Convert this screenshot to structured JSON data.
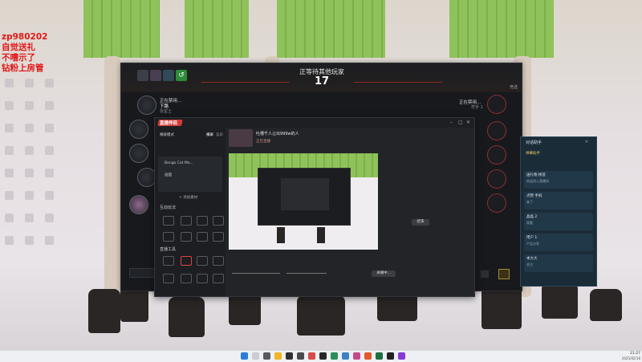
{
  "overlay_lines": [
    "zp980202",
    "自觉送礼",
    "不嘈示了",
    "钻粉上房管"
  ],
  "lobby": {
    "title": "正等待其他玩家",
    "countdown": "17",
    "left_player_status": "正在禁用...",
    "left_player_name": "下路",
    "left_player_sub": "张星士",
    "right_player_status": "正在禁用...",
    "right_player_sub": "符手 1",
    "top_right_label": "竞选"
  },
  "live_app": {
    "logo_text": "直播伴侣",
    "mode_label": "横屏模式",
    "mode_tabs": [
      "横屏",
      "竖屏"
    ],
    "scene_items": [
      "Bongo Cat Mo...",
      "画面"
    ],
    "add_scene": "+ 添加素材",
    "section_interactive": "互动玩法",
    "section_tools": "直播工具",
    "stream_title": "吐槽千人让出999w的人",
    "status_live": "正在直播",
    "buttons": {
      "go_live": "关播中...",
      "end": "结束"
    }
  },
  "chat_window": {
    "title": "对话助手",
    "tab": "弹幕助手",
    "rows": [
      {
        "name": "送礼物 榜首",
        "msg": "欢迎进入直播间"
      },
      {
        "name": "点赞 手机",
        "msg": "来了"
      },
      {
        "name": "晶晶 2",
        "msg": "观看"
      },
      {
        "name": "用户 1",
        "msg": "产品分享"
      },
      {
        "name": "本大大",
        "msg": "关注"
      }
    ]
  },
  "taskbar": {
    "time": "21:27",
    "date": "2025/02/18"
  },
  "colors": {
    "accent_red": "#e01818",
    "lobby_bg": "#17191d",
    "skirt_green": "#8fc25a"
  }
}
